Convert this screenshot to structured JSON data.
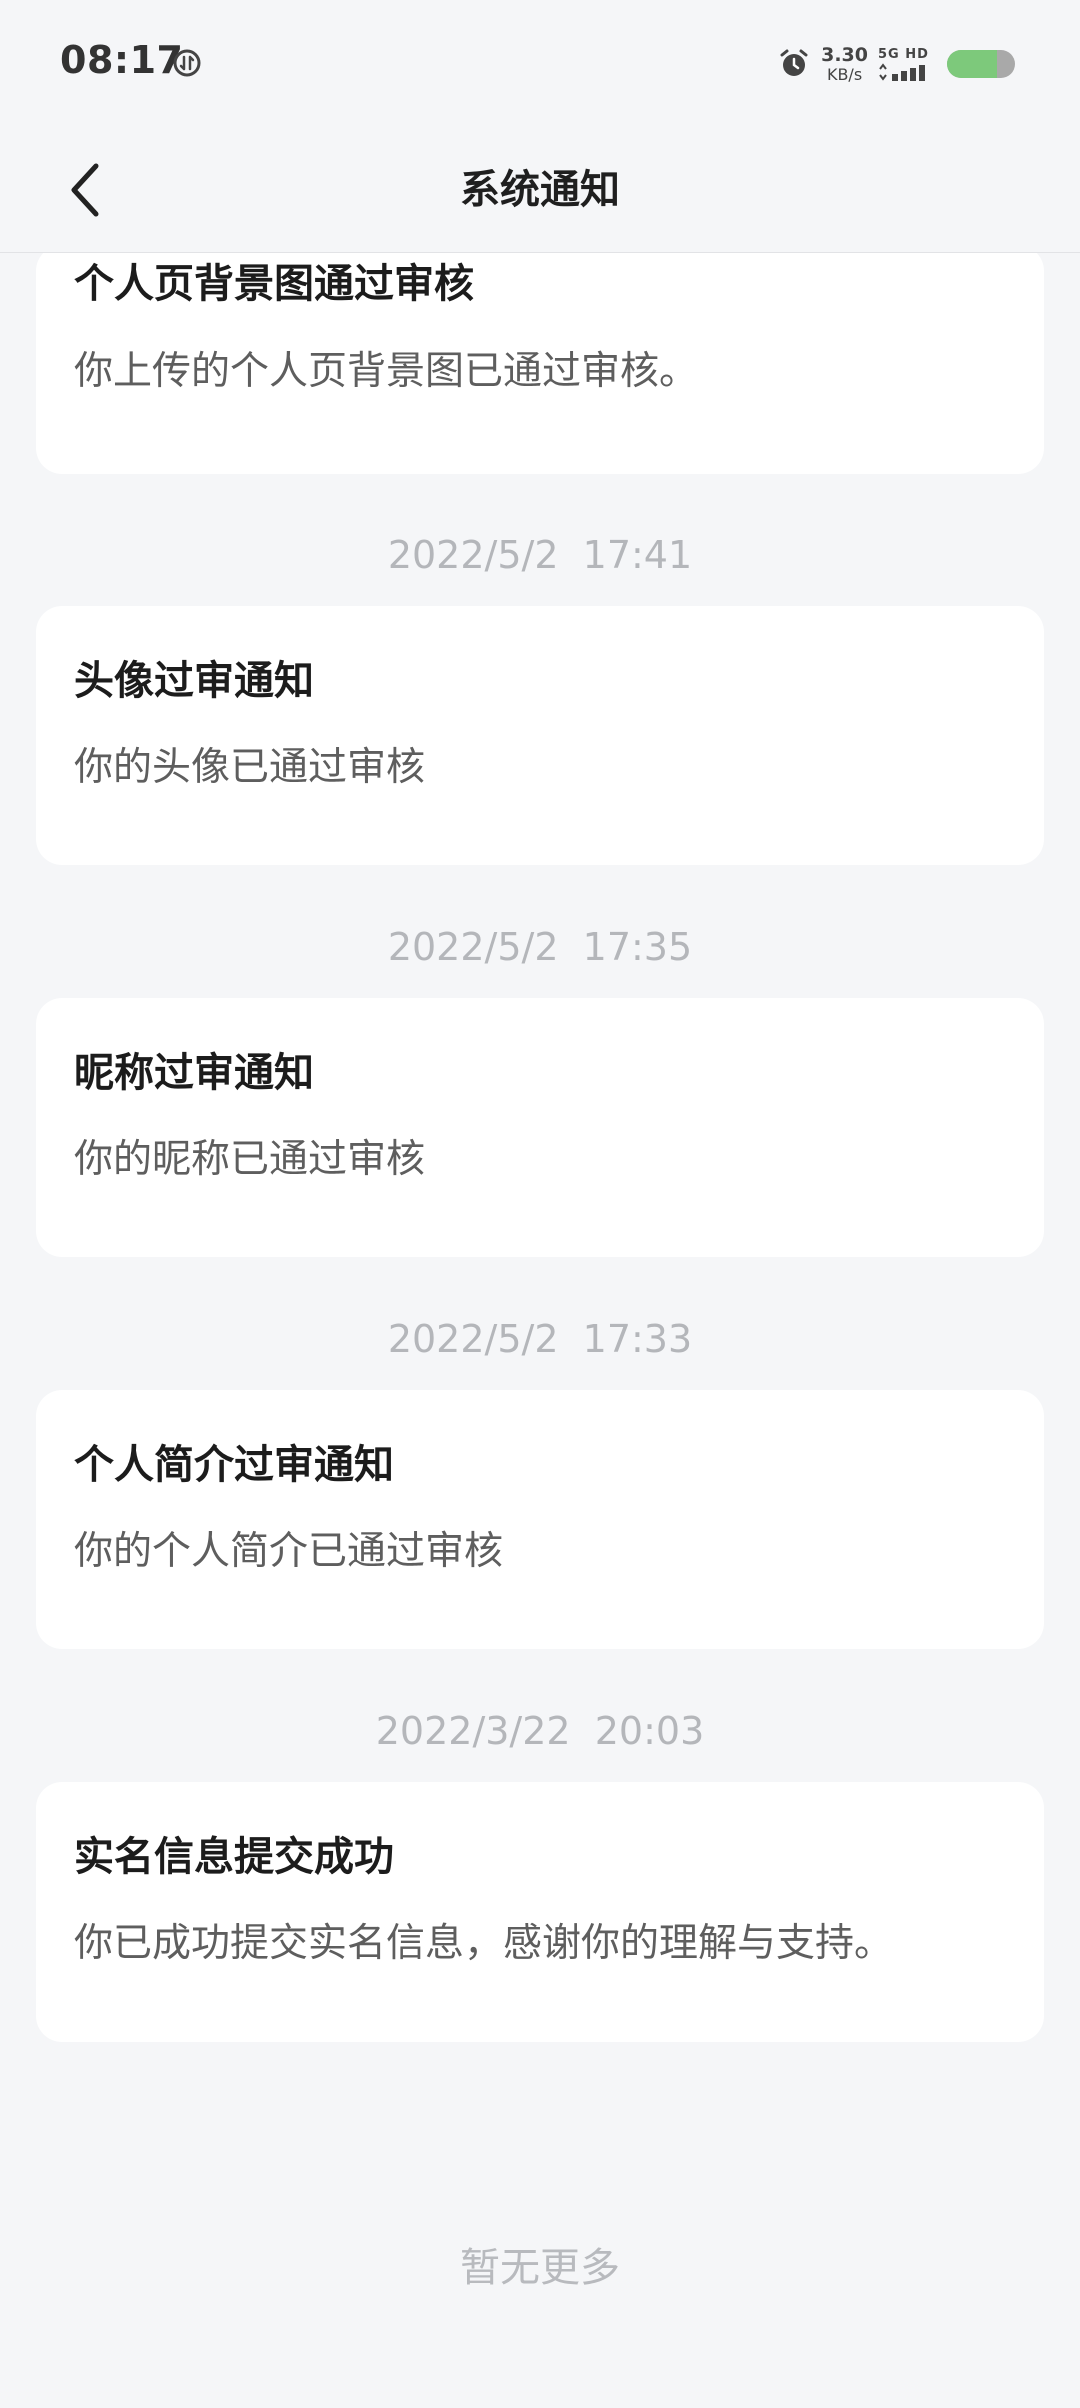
{
  "status_bar": {
    "time": "08:17",
    "net_speed_value": "3.30",
    "net_speed_unit": "KB/s",
    "signal_label": "5G HD",
    "battery_color": "#7dc97b"
  },
  "nav": {
    "back_icon": "chevron-left-icon",
    "title": "系统通知"
  },
  "notifications": [
    {
      "timestamp": "",
      "title": "个人页背景图通过审核",
      "body": "你上传的个人页背景图已通过审核。"
    },
    {
      "timestamp": "2022/5/2  17:41",
      "title": "头像过审通知",
      "body": "你的头像已通过审核"
    },
    {
      "timestamp": "2022/5/2  17:35",
      "title": "昵称过审通知",
      "body": "你的昵称已通过审核"
    },
    {
      "timestamp": "2022/5/2  17:33",
      "title": "个人简介过审通知",
      "body": "你的个人简介已通过审核"
    },
    {
      "timestamp": "2022/3/22  20:03",
      "title": "实名信息提交成功",
      "body": "你已成功提交实名信息，感谢你的理解与支持。"
    }
  ],
  "footer": {
    "no_more": "暂无更多"
  }
}
